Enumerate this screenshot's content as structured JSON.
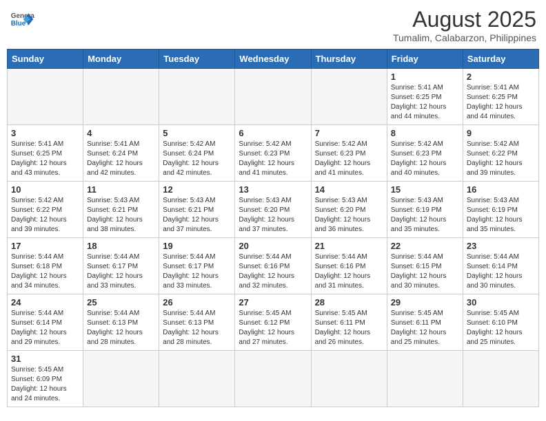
{
  "header": {
    "logo_line1": "General",
    "logo_line2": "Blue",
    "month_year": "August 2025",
    "location": "Tumalim, Calabarzon, Philippines"
  },
  "weekdays": [
    "Sunday",
    "Monday",
    "Tuesday",
    "Wednesday",
    "Thursday",
    "Friday",
    "Saturday"
  ],
  "weeks": [
    [
      {
        "day": "",
        "empty": true
      },
      {
        "day": "",
        "empty": true
      },
      {
        "day": "",
        "empty": true
      },
      {
        "day": "",
        "empty": true
      },
      {
        "day": "",
        "empty": true
      },
      {
        "day": "1",
        "sunrise": "5:41 AM",
        "sunset": "6:25 PM",
        "daylight": "12 hours and 44 minutes."
      },
      {
        "day": "2",
        "sunrise": "5:41 AM",
        "sunset": "6:25 PM",
        "daylight": "12 hours and 44 minutes."
      }
    ],
    [
      {
        "day": "3",
        "sunrise": "5:41 AM",
        "sunset": "6:25 PM",
        "daylight": "12 hours and 43 minutes."
      },
      {
        "day": "4",
        "sunrise": "5:41 AM",
        "sunset": "6:24 PM",
        "daylight": "12 hours and 42 minutes."
      },
      {
        "day": "5",
        "sunrise": "5:42 AM",
        "sunset": "6:24 PM",
        "daylight": "12 hours and 42 minutes."
      },
      {
        "day": "6",
        "sunrise": "5:42 AM",
        "sunset": "6:23 PM",
        "daylight": "12 hours and 41 minutes."
      },
      {
        "day": "7",
        "sunrise": "5:42 AM",
        "sunset": "6:23 PM",
        "daylight": "12 hours and 41 minutes."
      },
      {
        "day": "8",
        "sunrise": "5:42 AM",
        "sunset": "6:23 PM",
        "daylight": "12 hours and 40 minutes."
      },
      {
        "day": "9",
        "sunrise": "5:42 AM",
        "sunset": "6:22 PM",
        "daylight": "12 hours and 39 minutes."
      }
    ],
    [
      {
        "day": "10",
        "sunrise": "5:42 AM",
        "sunset": "6:22 PM",
        "daylight": "12 hours and 39 minutes."
      },
      {
        "day": "11",
        "sunrise": "5:43 AM",
        "sunset": "6:21 PM",
        "daylight": "12 hours and 38 minutes."
      },
      {
        "day": "12",
        "sunrise": "5:43 AM",
        "sunset": "6:21 PM",
        "daylight": "12 hours and 37 minutes."
      },
      {
        "day": "13",
        "sunrise": "5:43 AM",
        "sunset": "6:20 PM",
        "daylight": "12 hours and 37 minutes."
      },
      {
        "day": "14",
        "sunrise": "5:43 AM",
        "sunset": "6:20 PM",
        "daylight": "12 hours and 36 minutes."
      },
      {
        "day": "15",
        "sunrise": "5:43 AM",
        "sunset": "6:19 PM",
        "daylight": "12 hours and 35 minutes."
      },
      {
        "day": "16",
        "sunrise": "5:43 AM",
        "sunset": "6:19 PM",
        "daylight": "12 hours and 35 minutes."
      }
    ],
    [
      {
        "day": "17",
        "sunrise": "5:44 AM",
        "sunset": "6:18 PM",
        "daylight": "12 hours and 34 minutes."
      },
      {
        "day": "18",
        "sunrise": "5:44 AM",
        "sunset": "6:17 PM",
        "daylight": "12 hours and 33 minutes."
      },
      {
        "day": "19",
        "sunrise": "5:44 AM",
        "sunset": "6:17 PM",
        "daylight": "12 hours and 33 minutes."
      },
      {
        "day": "20",
        "sunrise": "5:44 AM",
        "sunset": "6:16 PM",
        "daylight": "12 hours and 32 minutes."
      },
      {
        "day": "21",
        "sunrise": "5:44 AM",
        "sunset": "6:16 PM",
        "daylight": "12 hours and 31 minutes."
      },
      {
        "day": "22",
        "sunrise": "5:44 AM",
        "sunset": "6:15 PM",
        "daylight": "12 hours and 30 minutes."
      },
      {
        "day": "23",
        "sunrise": "5:44 AM",
        "sunset": "6:14 PM",
        "daylight": "12 hours and 30 minutes."
      }
    ],
    [
      {
        "day": "24",
        "sunrise": "5:44 AM",
        "sunset": "6:14 PM",
        "daylight": "12 hours and 29 minutes."
      },
      {
        "day": "25",
        "sunrise": "5:44 AM",
        "sunset": "6:13 PM",
        "daylight": "12 hours and 28 minutes."
      },
      {
        "day": "26",
        "sunrise": "5:44 AM",
        "sunset": "6:13 PM",
        "daylight": "12 hours and 28 minutes."
      },
      {
        "day": "27",
        "sunrise": "5:45 AM",
        "sunset": "6:12 PM",
        "daylight": "12 hours and 27 minutes."
      },
      {
        "day": "28",
        "sunrise": "5:45 AM",
        "sunset": "6:11 PM",
        "daylight": "12 hours and 26 minutes."
      },
      {
        "day": "29",
        "sunrise": "5:45 AM",
        "sunset": "6:11 PM",
        "daylight": "12 hours and 25 minutes."
      },
      {
        "day": "30",
        "sunrise": "5:45 AM",
        "sunset": "6:10 PM",
        "daylight": "12 hours and 25 minutes."
      }
    ],
    [
      {
        "day": "31",
        "sunrise": "5:45 AM",
        "sunset": "6:09 PM",
        "daylight": "12 hours and 24 minutes."
      },
      {
        "day": "",
        "empty": true
      },
      {
        "day": "",
        "empty": true
      },
      {
        "day": "",
        "empty": true
      },
      {
        "day": "",
        "empty": true
      },
      {
        "day": "",
        "empty": true
      },
      {
        "day": "",
        "empty": true
      }
    ]
  ]
}
